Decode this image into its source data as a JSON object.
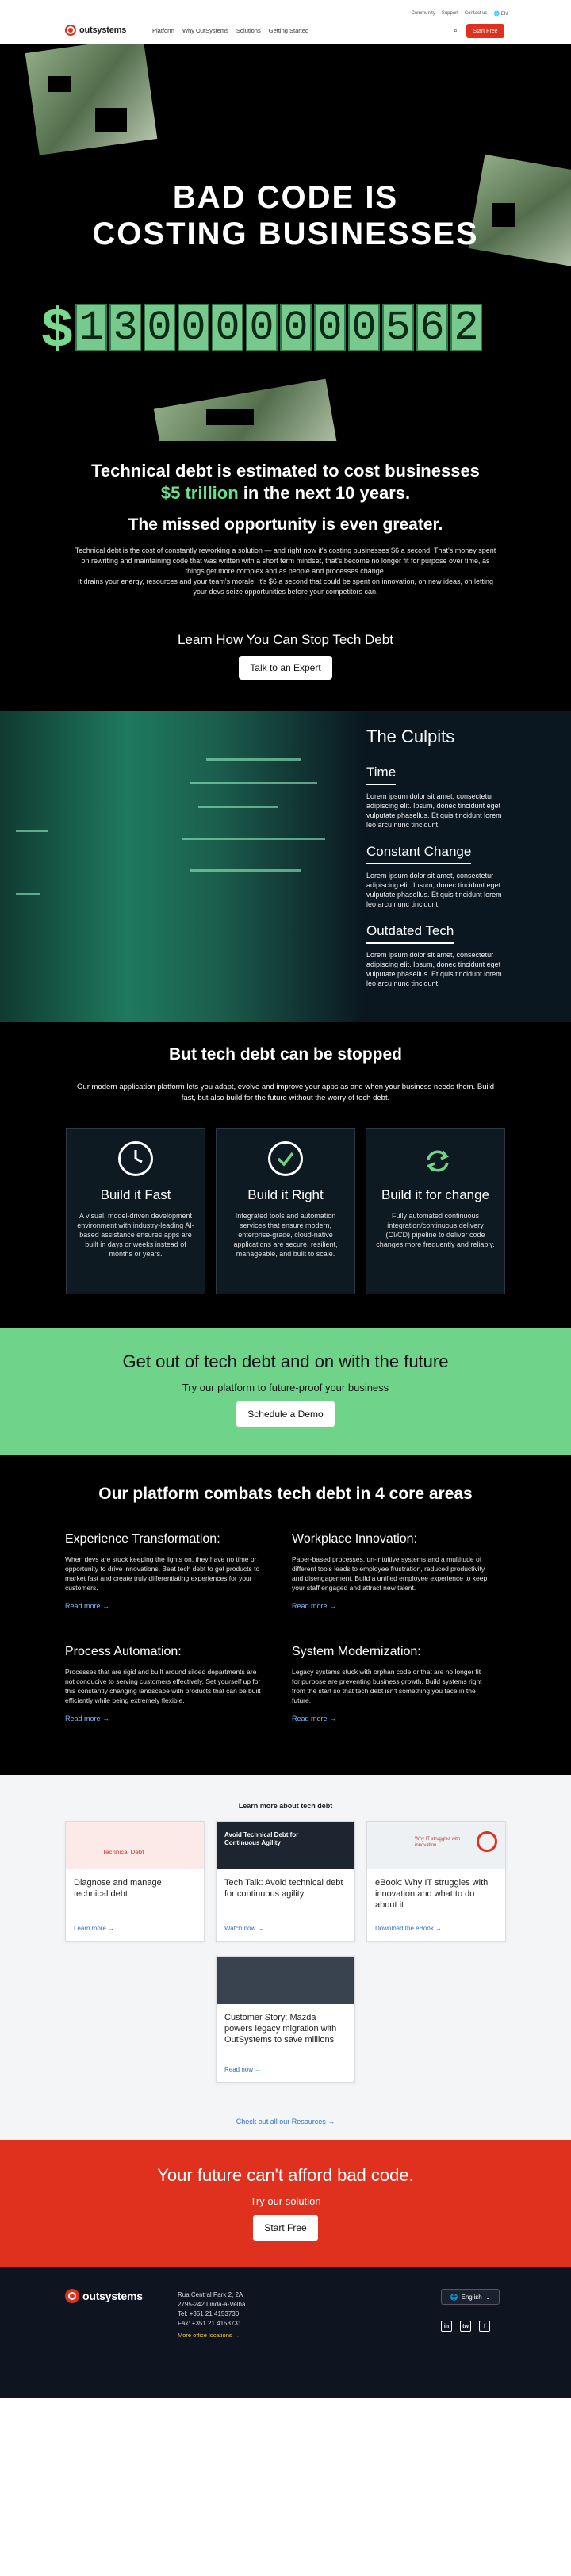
{
  "header": {
    "utility": [
      "Community",
      "Support",
      "Contact us",
      "EN"
    ],
    "brand": "outsystems",
    "nav": [
      "Platform",
      "Why OutSystems",
      "Solutions",
      "Getting Started"
    ],
    "cta": "Start Free",
    "search_icon": "search-icon"
  },
  "hero": {
    "title_line1": "BAD CODE IS",
    "title_line2": "COSTING BUSINESSES",
    "currency": "$",
    "counter_digits": [
      "1",
      "3",
      "0",
      "0",
      "0",
      "0",
      "0",
      "0",
      "0",
      "5",
      "6",
      "2"
    ]
  },
  "intro": {
    "headline_pre": "Technical debt is estimated to cost businesses",
    "headline_green": "$5 trillion",
    "headline_post": "in the next 10 years.",
    "subhead": "The missed opportunity is even greater.",
    "body1": "Technical debt is the cost of constantly reworking a solution — and right now it's costing businesses $6 a second. That's money spent on rewriting and maintaining code that was written with a short term mindset, that's become no longer fit for purpose over time, as things get more complex and as people and processes change.",
    "body2": "It drains your energy, resources and your team's morale. It's $6 a second that could be spent on innovation, on new ideas, on letting your devs seize opportunities before your competitors can.",
    "learn": "Learn How You Can Stop Tech Debt",
    "button": "Talk to an Expert"
  },
  "culprits": {
    "title": "The Culpits",
    "items": [
      {
        "title": "Time",
        "text": "Lorem ipsum dolor sit amet, consectetur adipiscing elit. Ipsum, donec tincidunt eget vulputate phasellus. Et quis tincidunt lorem leo arcu nunc tincidunt."
      },
      {
        "title": "Constant Change",
        "text": "Lorem ipsum dolor sit amet, consectetur adipiscing elit. Ipsum, donec tincidunt eget vulputate phasellus. Et quis tincidunt lorem leo arcu nunc tincidunt."
      },
      {
        "title": "Outdated Tech",
        "text": "Lorem ipsum dolor sit amet, consectetur adipiscing elit. Ipsum, donec tincidunt eget vulputate phasellus. Et quis tincidunt lorem leo arcu nunc tincidunt."
      }
    ]
  },
  "stopped": {
    "title": "But tech debt can be stopped",
    "lead": "Our modern application platform lets you adapt, evolve and improve your apps as and when your business needs them. Build fast, but also build for the future without the worry of tech debt.",
    "cards": [
      {
        "icon": "clock-icon",
        "title": "Build it Fast",
        "text": "A visual, model-driven development environment with industry-leading AI-based assistance ensures apps are built in days or weeks instead of months or years."
      },
      {
        "icon": "check-circle-icon",
        "title": "Build it Right",
        "text": "Integrated tools and automation services that ensure modern, enterprise-grade, cloud-native applications are secure, resilient, manageable, and built to scale."
      },
      {
        "icon": "refresh-icon",
        "title": "Build it for change",
        "text": "Fully automated continuous integration/continuous delivery (CI/CD) pipeline to deliver code changes more frequently and reliably."
      }
    ]
  },
  "green_cta": {
    "title": "Get out of tech debt and on with the future",
    "sub": "Try our platform to future-proof your business",
    "button": "Schedule a Demo"
  },
  "pillars": {
    "title": "Our platform combats tech debt in 4 core areas",
    "items": [
      {
        "title": "Experience Transformation:",
        "text": "When devs are stuck keeping the lights on, they have no time or opportunity to drive innovations. Beat tech debt to get products to market fast and create truly differentiating experiences for your customers.",
        "more": "Read more"
      },
      {
        "title": "Workplace Innovation:",
        "text": "Paper-based processes, un-intuitive systems and a multitude of different tools leads to employee frustration, reduced productivity and disengagement. Build a unified employee experience to keep your staff engaged and attract new talent.",
        "more": "Read more"
      },
      {
        "title": "Process Automation:",
        "text": "Processes that are rigid and built around siloed departments are not conducive to serving customers effectively. Set yourself up for this constantly changing landscape with products that can be built efficiently while being extremely flexible.",
        "more": "Read more"
      },
      {
        "title": "System Modernization:",
        "text": "Legacy systems stuck with orphan code or that are no longer fit for purpose are preventing business growth. Build systems right from the start so that tech debt isn't something you face in the future.",
        "more": "Read more"
      }
    ]
  },
  "resources": {
    "eyebrow": "Learn more about tech debt",
    "cards": [
      {
        "thumb": "Technical Debt",
        "title": "Diagnose and manage technical debt",
        "link": "Learn more"
      },
      {
        "thumb": "Avoid Technical Debt for Continuous Agility",
        "title": "Tech Talk: Avoid technical debt for continuous agility",
        "link": "Watch now"
      },
      {
        "thumb": "Why IT struggles with innovation",
        "title": "eBook: Why IT struggles with innovation and what to do about it",
        "link": "Download the eBook"
      },
      {
        "thumb": "",
        "title": "Customer Story: Mazda powers legacy migration with OutSystems to save millions",
        "link": "Read now"
      }
    ],
    "all": "Check out all our Resources"
  },
  "red_cta": {
    "title": "Your future can't afford bad code.",
    "sub": "Try our solution",
    "button": "Start Free"
  },
  "footer": {
    "brand": "outsystems",
    "address": [
      "Rua Central Park 2, 2A",
      "2795-242 Linda-a-Velha",
      "Tel: +351 21 4153730",
      "Fax: +351 21 4153731"
    ],
    "office": "More office locations",
    "language": "English",
    "socials": [
      "in",
      "tw",
      "f"
    ]
  },
  "colors": {
    "brand_red": "#e0301e",
    "accent_green": "#6fd48a",
    "link_blue": "#2f6fd1"
  }
}
